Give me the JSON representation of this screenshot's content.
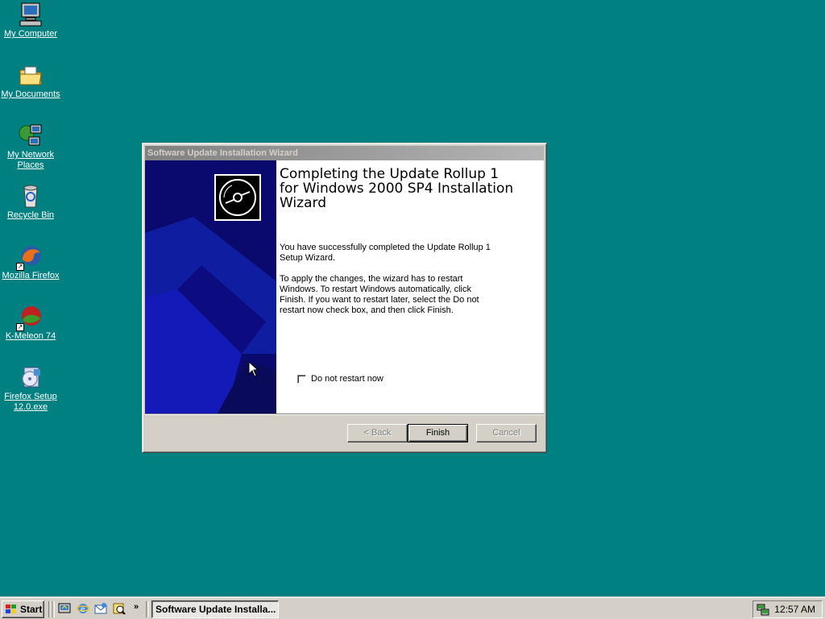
{
  "desktop": {
    "icons": [
      {
        "label": "My Computer",
        "icon": "computer-icon"
      },
      {
        "label": "My Documents",
        "icon": "folder-documents-icon"
      },
      {
        "label": "My Network Places",
        "icon": "network-icon"
      },
      {
        "label": "Recycle Bin",
        "icon": "recycle-bin-icon"
      },
      {
        "label": "Mozilla Firefox",
        "icon": "firefox-icon"
      },
      {
        "label": "K-Meleon 74",
        "icon": "kmeleon-icon"
      },
      {
        "label": "Firefox Setup 12.0.exe",
        "icon": "installer-icon"
      }
    ]
  },
  "wizard": {
    "window_title": "Software Update Installation Wizard",
    "heading": "Completing the Update Rollup 1 for Windows 2000 SP4 Installation Wizard",
    "paragraph1": "You have successfully completed the Update Rollup 1 Setup Wizard.",
    "paragraph2": "To apply the changes, the wizard has to restart Windows. To restart Windows automatically, click Finish. If you want to restart later, select the Do not restart now check box, and then click Finish.",
    "checkbox_label": "Do not restart now",
    "checkbox_checked": false,
    "buttons": {
      "back": "< Back",
      "finish": "Finish",
      "cancel": "Cancel"
    },
    "side_panel_color": "#0a0a6e"
  },
  "taskbar": {
    "start_label": "Start",
    "quick_launch": [
      "show-desktop-icon",
      "internet-explorer-icon",
      "outlook-express-icon",
      "search-icon"
    ],
    "chevron": "»",
    "active_task": "Software Update Installa...",
    "clock": "12:57 AM"
  },
  "colors": {
    "desktop": "#008080",
    "face": "#d4d0c8",
    "inactive_title": "#808080"
  }
}
